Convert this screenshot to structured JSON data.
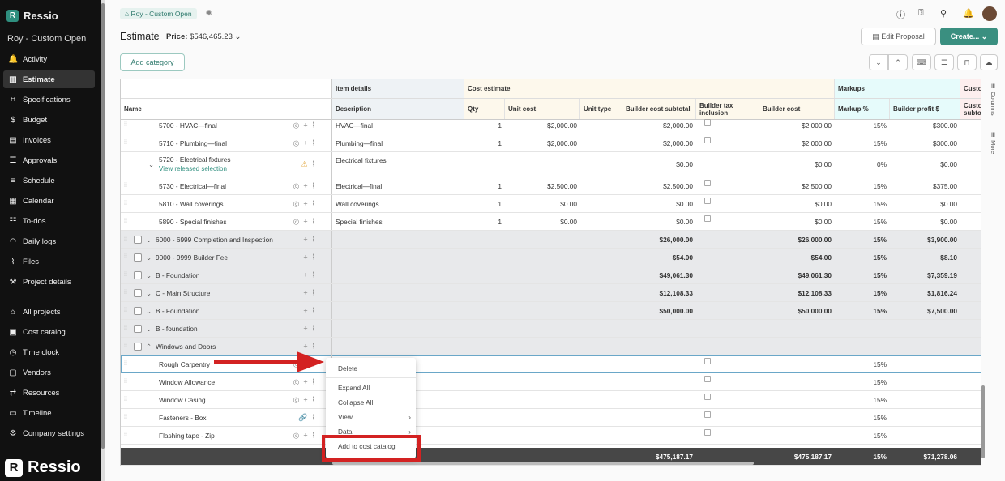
{
  "app": {
    "brand": "Ressio",
    "project": "Roy - Custom Open"
  },
  "sidebar": {
    "items": [
      {
        "label": "Activity",
        "icon": "bell-icon",
        "glyph": "🔔"
      },
      {
        "label": "Estimate",
        "icon": "chart-icon",
        "glyph": "▥",
        "active": true
      },
      {
        "label": "Specifications",
        "icon": "scan-icon",
        "glyph": "⌗"
      },
      {
        "label": "Budget",
        "icon": "dollar-icon",
        "glyph": "$"
      },
      {
        "label": "Invoices",
        "icon": "invoice-icon",
        "glyph": "▤"
      },
      {
        "label": "Approvals",
        "icon": "checklist-icon",
        "glyph": "☰"
      },
      {
        "label": "Schedule",
        "icon": "schedule-icon",
        "glyph": "≡"
      },
      {
        "label": "Calendar",
        "icon": "calendar-icon",
        "glyph": "▦"
      },
      {
        "label": "To-dos",
        "icon": "list-icon",
        "glyph": "☷"
      },
      {
        "label": "Daily logs",
        "icon": "rss-icon",
        "glyph": "◠"
      },
      {
        "label": "Files",
        "icon": "paperclip-icon",
        "glyph": "⌇"
      },
      {
        "label": "Project details",
        "icon": "wrench-icon",
        "glyph": "⚒"
      },
      {
        "label": "All projects",
        "icon": "home-icon",
        "glyph": "⌂"
      },
      {
        "label": "Cost catalog",
        "icon": "catalog-icon",
        "glyph": "▣"
      },
      {
        "label": "Time clock",
        "icon": "clock-icon",
        "glyph": "◷"
      },
      {
        "label": "Vendors",
        "icon": "vendor-icon",
        "glyph": "▢"
      },
      {
        "label": "Resources",
        "icon": "resources-icon",
        "glyph": "⇄"
      },
      {
        "label": "Timeline",
        "icon": "timeline-icon",
        "glyph": "▭"
      },
      {
        "label": "Company settings",
        "icon": "gear-icon",
        "glyph": "⚙"
      }
    ]
  },
  "breadcrumb": "Roy - Custom Open",
  "header": {
    "title": "Estimate",
    "price_label": "Price:",
    "price_value": "$546,465.23",
    "edit_proposal": "Edit Proposal",
    "create": "Create...",
    "add_category": "Add category"
  },
  "table": {
    "groups": {
      "item_details": "Item details",
      "cost_estimate": "Cost estimate",
      "markups": "Markups",
      "custom": "Custom"
    },
    "columns": {
      "name": "Name",
      "description": "Description",
      "qty": "Qty",
      "unit_cost": "Unit cost",
      "unit_type": "Unit type",
      "subtotal": "Builder cost subtotal",
      "tax": "Builder tax inclusion",
      "cost": "Builder cost",
      "markup": "Markup %",
      "profit": "Builder profit $",
      "custom_sub": "Custom subtotal"
    },
    "rows": [
      {
        "name": "5700 - HVAC—final",
        "t": "item",
        "desc": "HVAC—final",
        "qty": "1",
        "unit": "$2,000.00",
        "sub": "$2,000.00",
        "tax": true,
        "cost": "$2,000.00",
        "mk": "15%",
        "pf": "$300.00"
      },
      {
        "name": "5710 - Plumbing—final",
        "t": "item",
        "desc": "Plumbing—final",
        "qty": "1",
        "unit": "$2,000.00",
        "sub": "$2,000.00",
        "tax": true,
        "cost": "$2,000.00",
        "mk": "15%",
        "pf": "$300.00"
      },
      {
        "name": "5720 - Electrical fixtures",
        "t": "selection",
        "link": "View released selection",
        "desc": "Electrical fixtures",
        "qty": "",
        "unit": "",
        "sub": "$0.00",
        "tax": false,
        "cost": "$0.00",
        "mk": "0%",
        "pf": "$0.00"
      },
      {
        "name": "5730 - Electrical—final",
        "t": "item",
        "desc": "Electrical—final",
        "qty": "1",
        "unit": "$2,500.00",
        "sub": "$2,500.00",
        "tax": true,
        "cost": "$2,500.00",
        "mk": "15%",
        "pf": "$375.00"
      },
      {
        "name": "5810 - Wall coverings",
        "t": "item",
        "desc": "Wall coverings",
        "qty": "1",
        "unit": "$0.00",
        "sub": "$0.00",
        "tax": true,
        "cost": "$0.00",
        "mk": "15%",
        "pf": "$0.00"
      },
      {
        "name": "5890 - Special finishes",
        "t": "item",
        "desc": "Special finishes",
        "qty": "1",
        "unit": "$0.00",
        "sub": "$0.00",
        "tax": true,
        "cost": "$0.00",
        "mk": "15%",
        "pf": "$0.00"
      },
      {
        "name": "6000 - 6999 Completion and Inspection",
        "t": "group",
        "sub": "$26,000.00",
        "cost": "$26,000.00",
        "mk": "15%",
        "pf": "$3,900.00"
      },
      {
        "name": "9000 - 9999 Builder Fee",
        "t": "group",
        "sub": "$54.00",
        "cost": "$54.00",
        "mk": "15%",
        "pf": "$8.10"
      },
      {
        "name": "B - Foundation",
        "t": "group",
        "sub": "$49,061.30",
        "cost": "$49,061.30",
        "mk": "15%",
        "pf": "$7,359.19"
      },
      {
        "name": "C - Main Structure",
        "t": "group",
        "sub": "$12,108.33",
        "cost": "$12,108.33",
        "mk": "15%",
        "pf": "$1,816.24"
      },
      {
        "name": "B - Foundation",
        "t": "group",
        "sub": "$50,000.00",
        "cost": "$50,000.00",
        "mk": "15%",
        "pf": "$7,500.00"
      },
      {
        "name": "B - foundation",
        "t": "group",
        "sub": "",
        "cost": "",
        "mk": "",
        "pf": ""
      },
      {
        "name": "Windows and Doors",
        "t": "group",
        "open": true,
        "sub": "",
        "cost": "",
        "mk": "",
        "pf": ""
      },
      {
        "name": "Rough Carpentry",
        "t": "item",
        "selected": true,
        "tax": true,
        "mk": "15%"
      },
      {
        "name": "Window Allowance",
        "t": "item",
        "tax": true,
        "mk": "15%"
      },
      {
        "name": "Window Casing",
        "t": "item",
        "tax": true,
        "mk": "15%"
      },
      {
        "name": "Fasteners - Box",
        "t": "item",
        "linked": true,
        "tax": true,
        "mk": "15%"
      },
      {
        "name": "Flashing tape - Zip",
        "t": "item",
        "tax": true,
        "mk": "15%"
      }
    ],
    "totals": {
      "sub": "$475,187.17",
      "cost": "$475,187.17",
      "mk": "15%",
      "pf": "$71,278.06"
    }
  },
  "side_tabs": {
    "columns": "Columns",
    "more": "More"
  },
  "context_menu": {
    "items": [
      "Delete",
      "Expand All",
      "Collapse All",
      "View",
      "Data",
      "Add to cost catalog"
    ]
  },
  "colors": {
    "accent": "#2f8f7f",
    "highlight": "#d32222"
  }
}
